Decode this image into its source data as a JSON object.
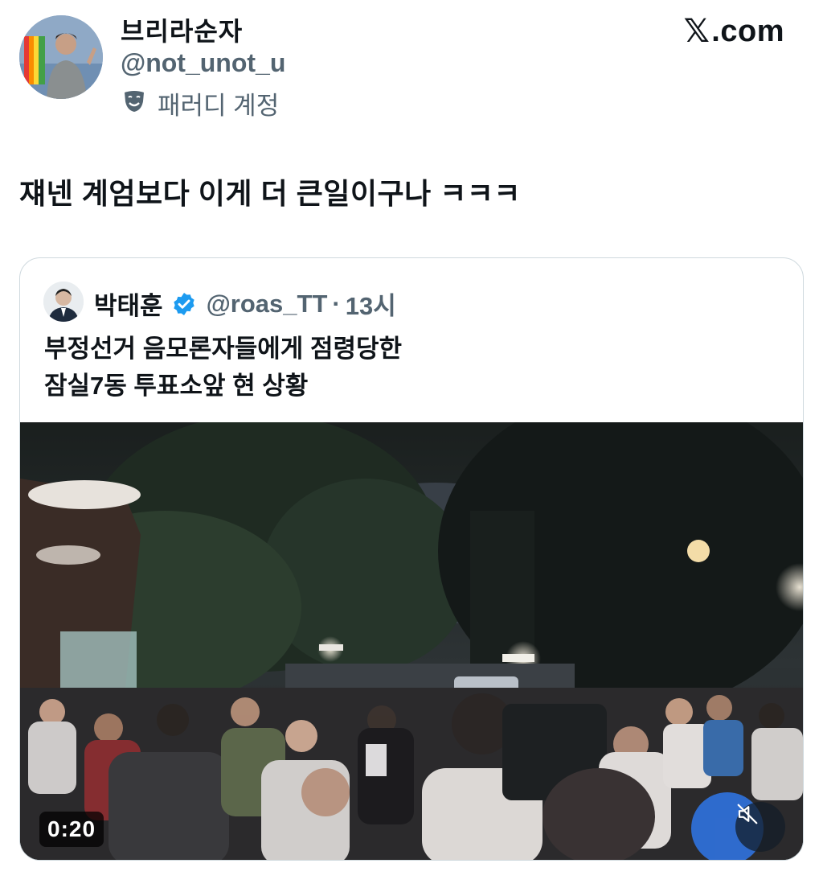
{
  "post": {
    "author": {
      "display_name": "브리라순자",
      "handle": "@not_unot_u",
      "parody_label": "패러디 계정"
    },
    "brand": {
      "x_glyph": "𝕏",
      "suffix": ".com"
    },
    "text": "쟤넨 계엄보다 이게 더 큰일이구나 ㅋㅋㅋ"
  },
  "quoted_post": {
    "author": {
      "display_name": "박태훈",
      "handle": "@roas_TT",
      "separator": "·",
      "time": "13시"
    },
    "text_lines": [
      "부정선거 음모론자들에게 점령당한",
      "잠실7동 투표소앞 현 상황"
    ],
    "video": {
      "duration": "0:20",
      "mute_icon": "muted-speaker-icon"
    }
  },
  "colors": {
    "text": "#0f1419",
    "secondary": "#536471",
    "verified": "#1d9bf0",
    "border": "#cfd9de"
  }
}
